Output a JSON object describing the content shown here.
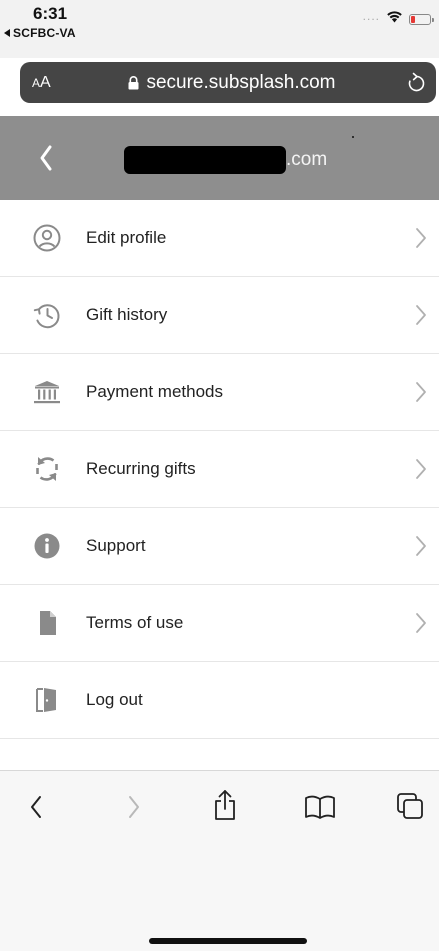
{
  "status_bar": {
    "time": "6:31",
    "back_app": "SCFBC-VA",
    "signal": "....",
    "battery_color": "#e53935"
  },
  "address_bar": {
    "text_size_label_small": "A",
    "text_size_label_large": "A",
    "url": "secure.subsplash.com",
    "lock_icon": "lock-icon",
    "reload_icon": "reload-icon"
  },
  "header": {
    "back_icon": "chevron-left-icon",
    "title_suffix": ".com",
    "background": "#8e8e8e"
  },
  "menu": {
    "items": [
      {
        "label": "Edit profile",
        "icon": "user-circle-icon",
        "chevron": true
      },
      {
        "label": "Gift history",
        "icon": "history-clock-icon",
        "chevron": true
      },
      {
        "label": "Payment methods",
        "icon": "bank-icon",
        "chevron": true
      },
      {
        "label": "Recurring gifts",
        "icon": "recurring-arrows-icon",
        "chevron": true
      },
      {
        "label": "Support",
        "icon": "info-icon",
        "chevron": true
      },
      {
        "label": "Terms of use",
        "icon": "document-icon",
        "chevron": true
      },
      {
        "label": "Log out",
        "icon": "logout-door-icon",
        "chevron": false
      }
    ]
  },
  "toolbar": {
    "back_icon": "back-arrow-icon",
    "forward_icon": "forward-arrow-icon",
    "share_icon": "share-icon",
    "bookmarks_icon": "bookmarks-icon",
    "tabs_icon": "tabs-icon"
  }
}
